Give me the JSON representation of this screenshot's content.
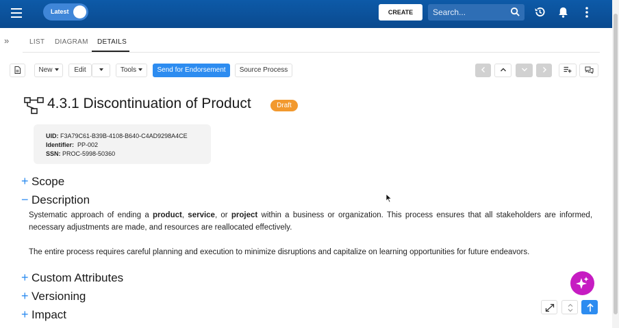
{
  "topbar": {
    "latest_label": "Latest",
    "create_label": "CREATE",
    "search_placeholder": "Search..."
  },
  "tabs": [
    "LIST",
    "DIAGRAM",
    "DETAILS"
  ],
  "toolbar": {
    "new_label": "New",
    "edit_label": "Edit",
    "tools_label": "Tools",
    "endorse_label": "Send for Endorsement",
    "source_label": "Source Process"
  },
  "process": {
    "title": "4.3.1 Discontinuation of Product",
    "status": "Draft",
    "uid_label": "UID:",
    "uid": "F3A79C61-B39B-4108-B640-C4AD9298A4CE",
    "identifier_label": "Identifier:",
    "identifier": "PP-002",
    "ssn_label": "SSN:",
    "ssn": "PROC-5998-50360"
  },
  "sections": {
    "scope": "Scope",
    "description": "Description",
    "custom_attributes": "Custom Attributes",
    "versioning": "Versioning",
    "impact": "Impact"
  },
  "description": {
    "p1_a": "Systematic approach of ending a ",
    "p1_b1": "product",
    "p1_c": ", ",
    "p1_b2": "service",
    "p1_d": ", or ",
    "p1_b3": "project",
    "p1_e": " within a business or organization. This process ensures that all stakeholders are informed, necessary adjustments are made, and resources are reallocated effectively.",
    "p2": "The entire process requires careful planning and execution to minimize disruptions and capitalize on learning opportunities for future endeavors."
  },
  "colors": {
    "brand": "#0a4a8f",
    "accent": "#2d8cf0",
    "draft": "#f2992e",
    "ai": "#c61cc2"
  }
}
